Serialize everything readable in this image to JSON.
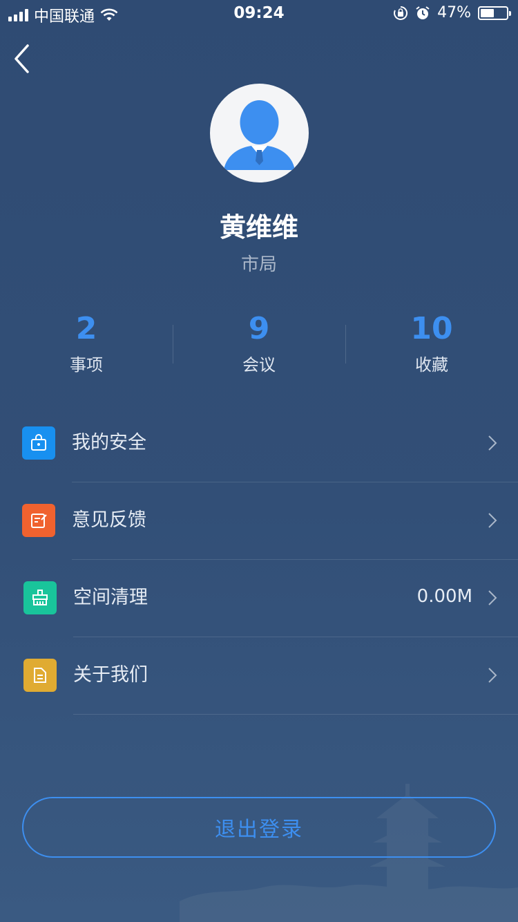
{
  "status_bar": {
    "carrier": "中国联通",
    "time": "09:24",
    "battery": "47%"
  },
  "profile": {
    "name": "黄维维",
    "department": "市局"
  },
  "stats": [
    {
      "value": "2",
      "label": "事项"
    },
    {
      "value": "9",
      "label": "会议"
    },
    {
      "value": "10",
      "label": "收藏"
    }
  ],
  "menu": [
    {
      "label": "我的安全",
      "icon": "lock-icon",
      "color": "#1890f0",
      "value": ""
    },
    {
      "label": "意见反馈",
      "icon": "feedback-icon",
      "color": "#f0622f",
      "value": ""
    },
    {
      "label": "空间清理",
      "icon": "broom-icon",
      "color": "#19c49b",
      "value": "0.00M"
    },
    {
      "label": "关于我们",
      "icon": "document-icon",
      "color": "#e0ab32",
      "value": ""
    }
  ],
  "logout_label": "退出登录",
  "colors": {
    "accent": "#3d8ff0",
    "background": "#324f77"
  }
}
